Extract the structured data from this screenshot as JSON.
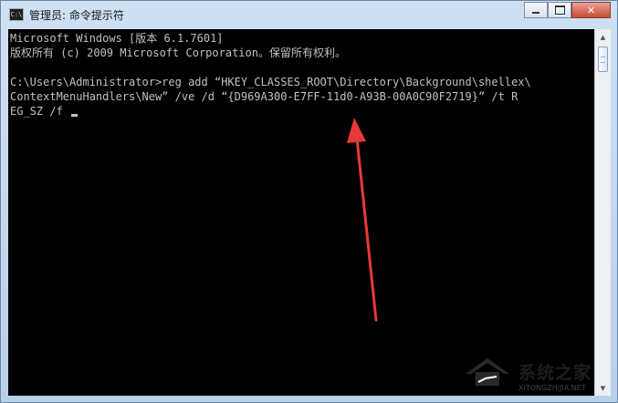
{
  "window": {
    "title": "管理员: 命令提示符",
    "icon_text": "C:\\",
    "icon": "console-icon",
    "controls": {
      "minimize_icon": "minimize-icon",
      "maximize_icon": "maximize-icon",
      "close_icon": "close-icon",
      "close_glyph": "✕"
    }
  },
  "console": {
    "lines": [
      "Microsoft Windows [版本 6.1.7601]",
      "版权所有 (c) 2009 Microsoft Corporation。保留所有权利。",
      "",
      "C:\\Users\\Administrator>reg add “HKEY_CLASSES_ROOT\\Directory\\Background\\shellex\\",
      "ContextMenuHandlers\\New” /ve /d “{D969A300-E7FF-11d0-A93B-00A0C90F2719}” /t R",
      "EG_SZ /f "
    ],
    "colors": {
      "background": "#000000",
      "text": "#c0c0c0"
    }
  },
  "annotation": {
    "arrow_color": "#e53a3a"
  },
  "watermark": {
    "text": "系统之家",
    "url": "XITONGZHIJIA.NET"
  },
  "scrollbar": {
    "up_glyph": "▲",
    "down_glyph": "▼"
  }
}
